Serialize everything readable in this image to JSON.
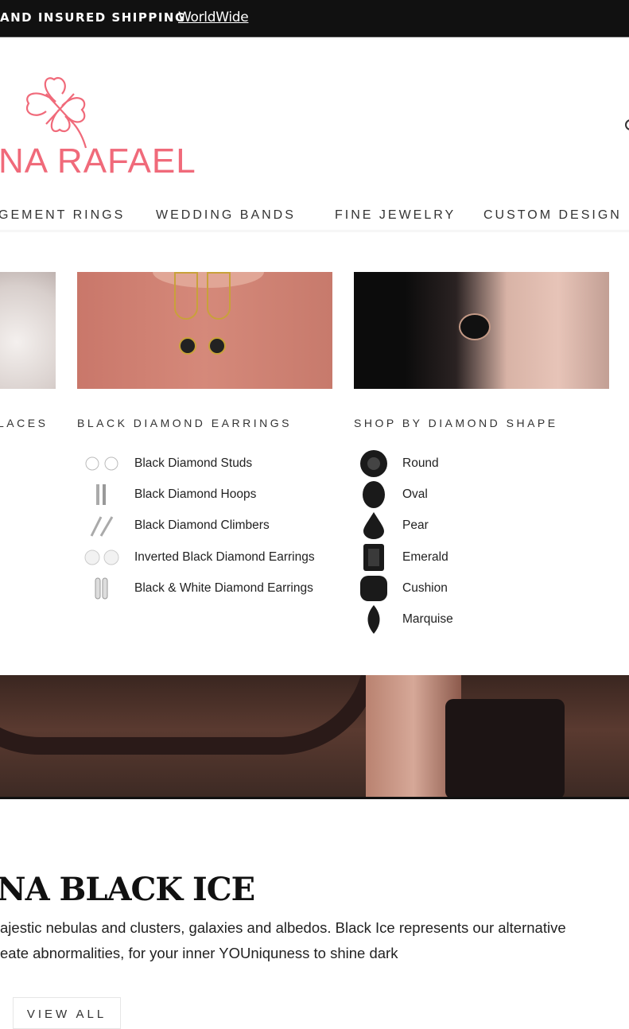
{
  "announcement": {
    "text": "AND INSURED SHIPPING",
    "link": "WorldWide"
  },
  "brand": {
    "logo_text": "NA RAFAEL",
    "color": "#f06a7a"
  },
  "nav": [
    "GEMENT RINGS",
    "WEDDING BANDS",
    "FINE JEWELRY",
    "CUSTOM DESIGN"
  ],
  "menu": {
    "col0": {
      "heading": "LACES"
    },
    "col1": {
      "heading": "BLACK DIAMOND EARRINGS",
      "items": [
        {
          "label": "Black Diamond Studs",
          "icon": "studs-icon"
        },
        {
          "label": "Black Diamond Hoops",
          "icon": "hoops-icon"
        },
        {
          "label": "Black Diamond Climbers",
          "icon": "climbers-icon"
        },
        {
          "label": "Inverted Black Diamond Earrings",
          "icon": "inverted-earrings-icon"
        },
        {
          "label": "Black & White Diamond Earrings",
          "icon": "black-white-earrings-icon"
        }
      ]
    },
    "col2": {
      "heading": "SHOP BY DIAMOND SHAPE",
      "items": [
        {
          "label": "Round",
          "icon": "round-diamond-icon"
        },
        {
          "label": "Oval",
          "icon": "oval-diamond-icon"
        },
        {
          "label": "Pear",
          "icon": "pear-diamond-icon"
        },
        {
          "label": "Emerald",
          "icon": "emerald-diamond-icon"
        },
        {
          "label": "Cushion",
          "icon": "cushion-diamond-icon"
        },
        {
          "label": "Marquise",
          "icon": "marquise-diamond-icon"
        }
      ]
    }
  },
  "collection": {
    "title": "NA BLACK ICE",
    "line1": "ajestic nebulas and clusters, galaxies and albedos. Black Ice represents our alternative",
    "line2": "eate abnormalities, for your inner YOUniquness to shine dark",
    "button": "VIEW ALL"
  }
}
